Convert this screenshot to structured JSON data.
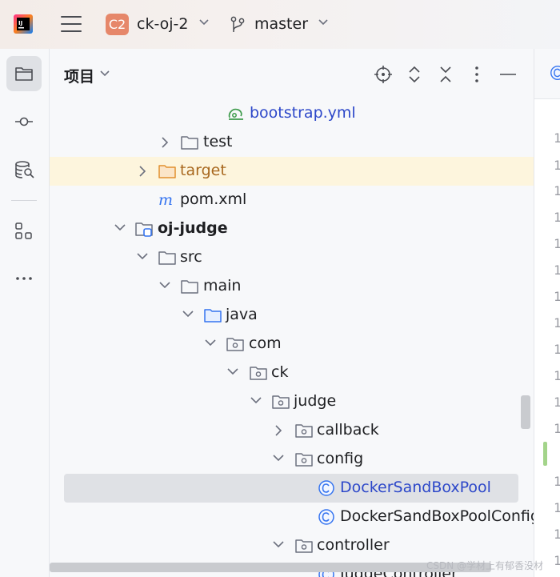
{
  "toolbar": {
    "project_badge": "C2",
    "project_name": "ck-oj-2",
    "branch": "master"
  },
  "panel": {
    "title": "项目"
  },
  "tree": [
    {
      "label": "bootstrap.yml",
      "icon": "yaml-file-icon",
      "expanded": null
    },
    {
      "label": "test",
      "icon": "folder-icon",
      "expanded": false
    },
    {
      "label": "target",
      "icon": "excluded-folder-icon",
      "expanded": false
    },
    {
      "label": "pom.xml",
      "icon": "maven-file-icon",
      "expanded": null
    },
    {
      "label": "oj-judge",
      "icon": "module-folder-icon",
      "expanded": true
    },
    {
      "label": "src",
      "icon": "folder-icon",
      "expanded": true
    },
    {
      "label": "main",
      "icon": "folder-icon",
      "expanded": true
    },
    {
      "label": "java",
      "icon": "source-folder-icon",
      "expanded": true
    },
    {
      "label": "com",
      "icon": "package-icon",
      "expanded": true
    },
    {
      "label": "ck",
      "icon": "package-icon",
      "expanded": true
    },
    {
      "label": "judge",
      "icon": "package-icon",
      "expanded": true
    },
    {
      "label": "callback",
      "icon": "package-icon",
      "expanded": false
    },
    {
      "label": "config",
      "icon": "package-icon",
      "expanded": true
    },
    {
      "label": "DockerSandBoxPool",
      "icon": "class-icon",
      "expanded": null,
      "selected": true
    },
    {
      "label": "DockerSandBoxPoolConfig",
      "icon": "class-icon",
      "expanded": null
    },
    {
      "label": "controller",
      "icon": "package-icon",
      "expanded": true
    },
    {
      "label": "JudgeController",
      "icon": "class-icon",
      "expanded": null
    }
  ],
  "editor": {
    "line_number_glyph": "1"
  },
  "watermark": "CSDN @学材上有郁香没材",
  "colors": {
    "accent_blue": "#2c47c9",
    "selection": "#dfe1e5",
    "target_highlight": "#fdf5dd",
    "target_text": "#a8681f",
    "project_badge": "#e6876a"
  }
}
